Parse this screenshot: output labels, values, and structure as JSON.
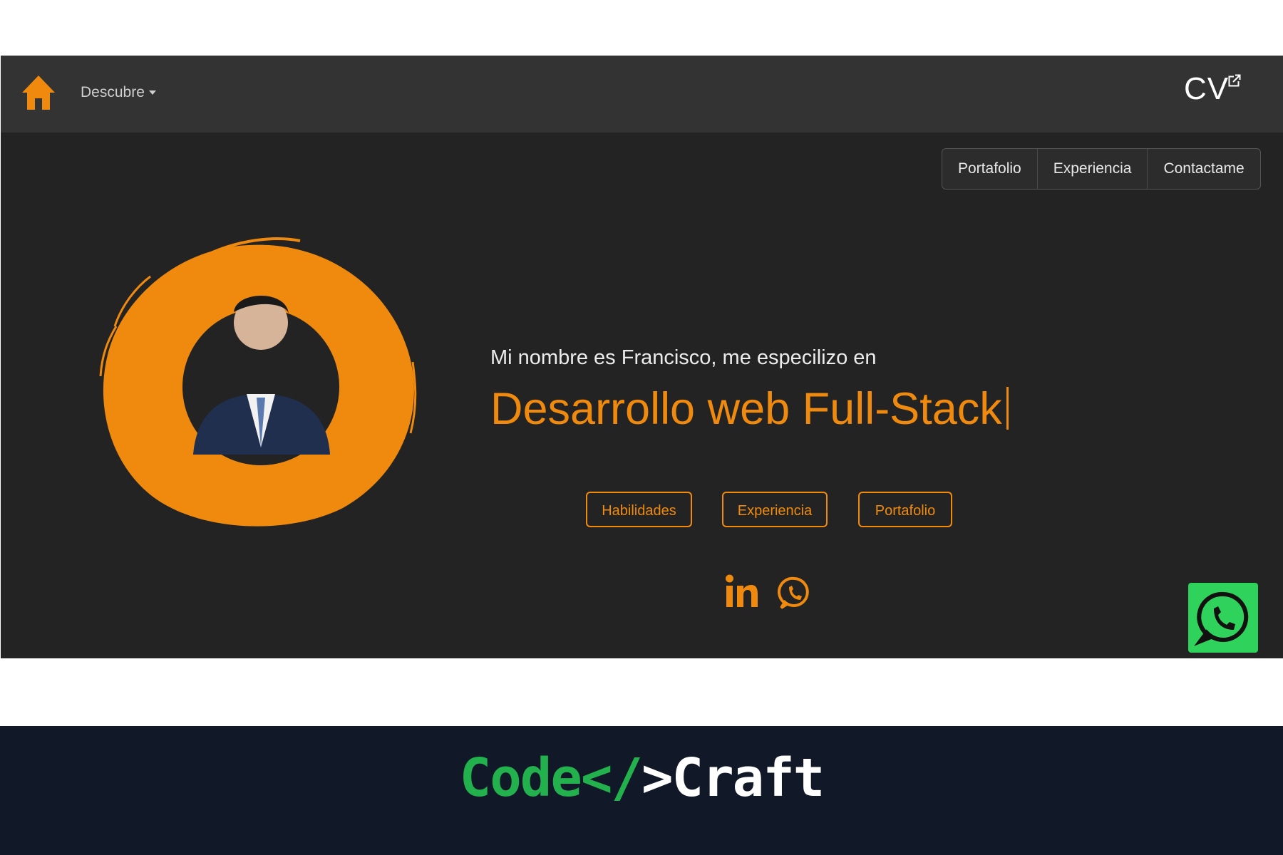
{
  "navbar": {
    "home_icon": "home-icon",
    "menu_label": "Descubre",
    "cv_label": "CV",
    "cv_icon": "external-link-icon"
  },
  "tabs": [
    {
      "label": "Portafolio"
    },
    {
      "label": "Experiencia"
    },
    {
      "label": "Contactame"
    }
  ],
  "hero": {
    "intro": "Mi nombre es Francisco, me especilizo en",
    "headline": "Desarrollo web Full-Stack",
    "buttons": [
      {
        "label": "Habilidades"
      },
      {
        "label": "Experiencia"
      },
      {
        "label": "Portafolio"
      }
    ],
    "social_icons": [
      "linkedin-icon",
      "whatsapp-icon"
    ]
  },
  "whatsapp_button_icon": "whatsapp-icon",
  "brand": {
    "part1": "Code",
    "part2": "</",
    "part3": ">Craft"
  },
  "colors": {
    "accent": "#ef8a0e",
    "page_bg": "#232323",
    "navbar_bg": "#333333",
    "whatsapp_green": "#2fd35c",
    "footer_bg": "#111827",
    "brand_green": "#22b14c"
  }
}
